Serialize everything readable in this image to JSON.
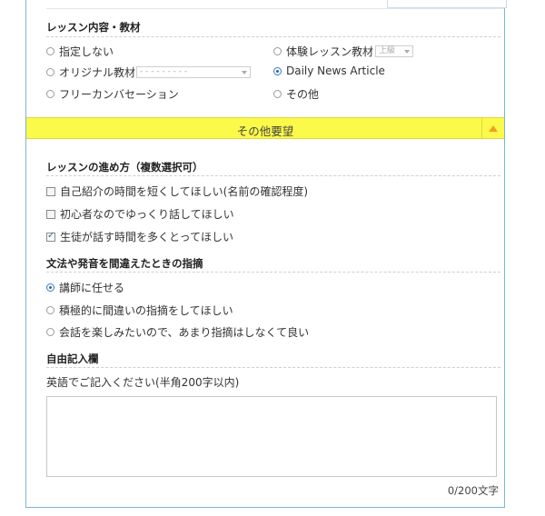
{
  "lesson_content": {
    "title": "レッスン内容・教材",
    "options_left": [
      {
        "label": "指定しない",
        "selected": false
      },
      {
        "label": "オリジナル教材",
        "selected": false,
        "select_value": "- - - - - - - - -"
      },
      {
        "label": "フリーカンバセーション",
        "selected": false
      }
    ],
    "options_right": [
      {
        "label": "体験レッスン教材",
        "selected": false,
        "select_value": "上級"
      },
      {
        "label": "Daily News Article",
        "selected": true
      },
      {
        "label": "その他",
        "selected": false
      }
    ]
  },
  "other_requests": {
    "title": "その他要望",
    "toggle_icon": "triangle-up-icon",
    "accent_color": "#fbf94a"
  },
  "lesson_style": {
    "title": "レッスンの進め方（複数選択可）",
    "options": [
      {
        "label": "自己紹介の時間を短くしてほしい(名前の確認程度)",
        "checked": false
      },
      {
        "label": "初心者なのでゆっくり話してほしい",
        "checked": false
      },
      {
        "label": "生徒が話す時間を多くとってほしい",
        "checked": true
      }
    ]
  },
  "correction": {
    "title": "文法や発音を間違えたときの指摘",
    "options": [
      {
        "label": "講師に任せる",
        "selected": true
      },
      {
        "label": "積極的に間違いの指摘をしてほしい",
        "selected": false
      },
      {
        "label": "会話を楽しみたいので、あまり指摘はしなくて良い",
        "selected": false
      }
    ]
  },
  "free_text": {
    "title": "自由記入欄",
    "instruction": "英語でご記入ください(半角200字以内)",
    "value": "",
    "counter": "0/200文字"
  }
}
